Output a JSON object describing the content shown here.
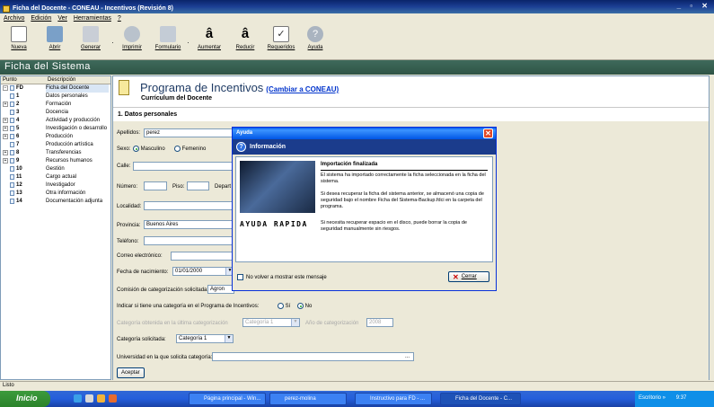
{
  "window": {
    "title": "Ficha del Docente - CONEAU - Incentivos (Revisión 8)",
    "controls": "_ ▫ ✕"
  },
  "menu": [
    "Archivo",
    "Edición",
    "Ver",
    "Herramientas",
    "?"
  ],
  "toolbar": {
    "buttons": [
      {
        "label": "Nueva",
        "icon": "new-document-icon"
      },
      {
        "label": "Abrir",
        "icon": "open-folder-icon"
      },
      {
        "label": "Generar",
        "icon": "generate-icon"
      },
      {
        "label": "Imprimir",
        "icon": "printer-icon"
      },
      {
        "label": "Formulario",
        "icon": "form-icon"
      },
      {
        "label": "Aumentar",
        "icon": "font-increase-icon"
      },
      {
        "label": "Reducir",
        "icon": "font-decrease-icon"
      },
      {
        "label": "Requeridos",
        "icon": "required-check-icon"
      },
      {
        "label": "Ayuda",
        "icon": "help-icon"
      }
    ]
  },
  "app_header": "Ficha del Sistema",
  "sidebar": {
    "headers": [
      "Punto",
      "Descripción"
    ],
    "items": [
      {
        "num": "FD",
        "desc": "Ficha del Docente",
        "expand": "−"
      },
      {
        "num": "1",
        "desc": "Datos personales",
        "expand": ""
      },
      {
        "num": "2",
        "desc": "Formación",
        "expand": "+"
      },
      {
        "num": "3",
        "desc": "Docencia",
        "expand": ""
      },
      {
        "num": "4",
        "desc": "Actividad y producción",
        "expand": "+"
      },
      {
        "num": "5",
        "desc": "Investigación o desarrollo",
        "expand": "+"
      },
      {
        "num": "6",
        "desc": "Producción",
        "expand": "+"
      },
      {
        "num": "7",
        "desc": "Producción artística",
        "expand": ""
      },
      {
        "num": "8",
        "desc": "Transferencias",
        "expand": "+"
      },
      {
        "num": "9",
        "desc": "Recursos humanos",
        "expand": "+"
      },
      {
        "num": "10",
        "desc": "Gestión",
        "expand": ""
      },
      {
        "num": "11",
        "desc": "Cargo actual",
        "expand": ""
      },
      {
        "num": "12",
        "desc": "Investigador",
        "expand": ""
      },
      {
        "num": "13",
        "desc": "Otra información",
        "expand": ""
      },
      {
        "num": "14",
        "desc": "Documentación adjunta",
        "expand": ""
      }
    ]
  },
  "page": {
    "title": "Programa de Incentivos",
    "link": "(Cambiar a CONEAU)",
    "subtitle": "Currículum del Docente",
    "section": "1. Datos personales"
  },
  "form": {
    "apellidos_label": "Apellidos:",
    "apellidos_value": "perez",
    "sexo_label": "Sexo:",
    "sexo_m": "Masculino",
    "sexo_f": "Femenino",
    "calle_label": "Calle:",
    "numero_label": "Número:",
    "piso_label": "Piso:",
    "depto_label": "Depart",
    "localidad_label": "Localidad:",
    "provincia_label": "Provincia:",
    "provincia_value": "Buenos Aires",
    "telefono_label": "Teléfono:",
    "correo_label": "Correo electrónico:",
    "nacimiento_label": "Fecha de nacimiento:",
    "nacimiento_value": "01/01/2000",
    "comision_label": "Comisión de categorización solicitada:",
    "comision_value": "Agron",
    "tiene_cat_label": "Indicar si tiene una categoría en el Programa de Incentivos:",
    "si": "Sí",
    "no": "No",
    "cat_obtenida_label": "Categoría obtenida en la última categorización",
    "cat_obtenida_value": "Categoría 1",
    "anio_label": "Año de categorización",
    "anio_value": "2008",
    "cat_solicitada_label": "Categoría solicitada:",
    "cat_solicitada_value": "Categoría 1",
    "universidad_label": "Universidad en la que solicita categoría:",
    "universidad_btn": "...",
    "aceptar": "Aceptar"
  },
  "dialog": {
    "title": "Ayuda",
    "info": "Información",
    "image_text": "AYUDA RAPIDA",
    "heading": "Importación finalizada",
    "p1": "El sistema ha importado correctamente la ficha seleccionada en la ficha del sistema.",
    "p2": "Si desea recuperar la ficha del sistema anterior, se almacenó una copia de seguridad bajo el nombre Ficha del Sistema-Backup.fdci en la carpeta del programa.",
    "p3": "Si necesita recuperar espacio en el disco, puede borrar la copia de seguridad manualmente sin riesgos.",
    "checkbox": "No volver a mostrar este mensaje",
    "close": "Cerrar"
  },
  "status": "Listo",
  "taskbar": {
    "start": "Inicio",
    "tasks": [
      "Página principal - Win...",
      "perez-molina",
      "Instructivo para FD - ...",
      "Ficha del Docente - C..."
    ],
    "tray_label": "Escritorio",
    "clock": "9:37"
  }
}
